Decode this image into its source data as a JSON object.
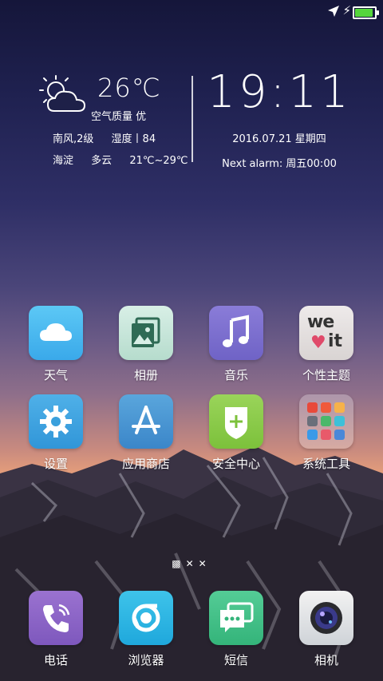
{
  "status_bar": {
    "icons": [
      "navigation-arrow-icon",
      "charging-bolt-icon",
      "battery-icon"
    ],
    "battery_level": 1.0,
    "battery_color": "#55d63c"
  },
  "weather": {
    "icon": "partly-cloudy-icon",
    "temperature": "26℃",
    "air_quality": "空气质量 优",
    "wind": "南风,2级",
    "humidity": "湿度丨84",
    "location": "海淀",
    "condition": "多云",
    "range": "21℃~29℃"
  },
  "clock": {
    "time": "19:11",
    "date": "2016.07.21  星期四",
    "alarm": "Next alarm: 周五00:00"
  },
  "apps": [
    {
      "label": "天气",
      "icon": "weather-cloud-icon"
    },
    {
      "label": "相册",
      "icon": "gallery-photo-icon"
    },
    {
      "label": "音乐",
      "icon": "music-note-icon"
    },
    {
      "label": "个性主题",
      "icon": "themes-we-it-icon",
      "icon_text_1": "we",
      "icon_text_2": "it"
    },
    {
      "label": "设置",
      "icon": "settings-gear-icon"
    },
    {
      "label": "应用商店",
      "icon": "app-store-icon"
    },
    {
      "label": "安全中心",
      "icon": "security-shield-icon"
    },
    {
      "label": "系统工具",
      "icon": "folder-system-tools-icon"
    }
  ],
  "page_indicator": {
    "pages": 3,
    "current": 1
  },
  "dock": [
    {
      "label": "电话",
      "icon": "phone-icon"
    },
    {
      "label": "浏览器",
      "icon": "browser-icon"
    },
    {
      "label": "短信",
      "icon": "messages-icon"
    },
    {
      "label": "相机",
      "icon": "camera-icon"
    }
  ]
}
